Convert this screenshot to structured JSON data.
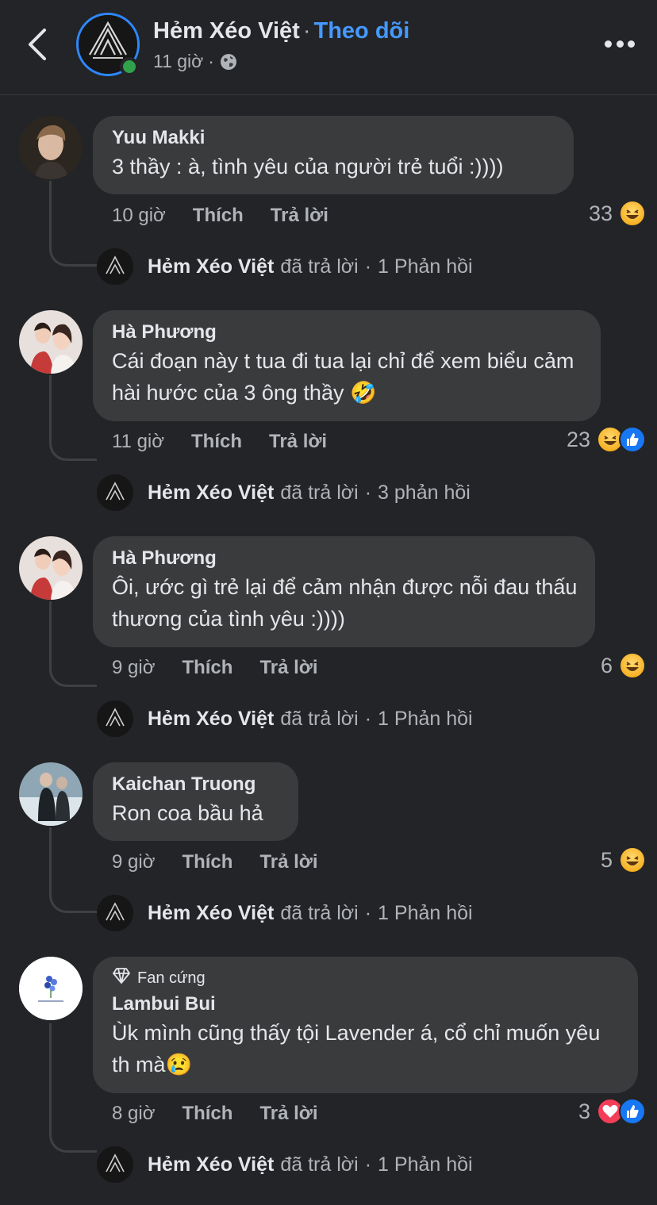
{
  "header": {
    "page_name": "Hẻm Xéo Việt",
    "separator": "·",
    "follow_label": "Theo dõi",
    "time": "11 giờ",
    "meta_separator": "·",
    "icons": [
      "back-chevron-icon",
      "globe-icon",
      "more-icon"
    ],
    "online_color": "#31a24c",
    "avatar_ring_color": "#2d88ff"
  },
  "labels": {
    "like": "Thích",
    "reply": "Trả lời",
    "replied": "đã trả lời",
    "dot": "·"
  },
  "comments": [
    {
      "author": "Yuu Makki",
      "text": "3 thầy : à, tình yêu của người trẻ tuổi :))))",
      "time": "10 giờ",
      "reaction_count": "33",
      "reactions": [
        "haha"
      ],
      "reply_author": "Hẻm Xéo Việt",
      "reply_count": "1 Phản hồi"
    },
    {
      "author": "Hà Phương",
      "text": "Cái đoạn này t tua đi tua lại chỉ để xem biểu cảm hài hước của 3 ông thầy 🤣",
      "time": "11 giờ",
      "reaction_count": "23",
      "reactions": [
        "haha",
        "like"
      ],
      "reply_author": "Hẻm Xéo Việt",
      "reply_count": "3 phản hồi"
    },
    {
      "author": "Hà Phương",
      "text": "Ôi, ước gì trẻ lại để cảm nhận được nỗi đau thấu thương của tình yêu :))))",
      "time": "9 giờ",
      "reaction_count": "6",
      "reactions": [
        "haha"
      ],
      "reply_author": "Hẻm Xéo Việt",
      "reply_count": "1 Phản hồi"
    },
    {
      "author": "Kaichan Truong",
      "text": "Ron coa bầu hả",
      "time": "9 giờ",
      "reaction_count": "5",
      "reactions": [
        "haha"
      ],
      "reply_author": "Hẻm Xéo Việt",
      "reply_count": "1 Phản hồi"
    },
    {
      "badge": "Fan cứng",
      "author": "Lambui Bui",
      "text": "Ùk mình cũng thấy tội Lavender á, cổ chỉ muốn yêu th mà😢",
      "time": "8 giờ",
      "reaction_count": "3",
      "reactions": [
        "love",
        "like"
      ],
      "reply_author": "Hẻm Xéo Việt",
      "reply_count": "1 Phản hồi"
    }
  ]
}
